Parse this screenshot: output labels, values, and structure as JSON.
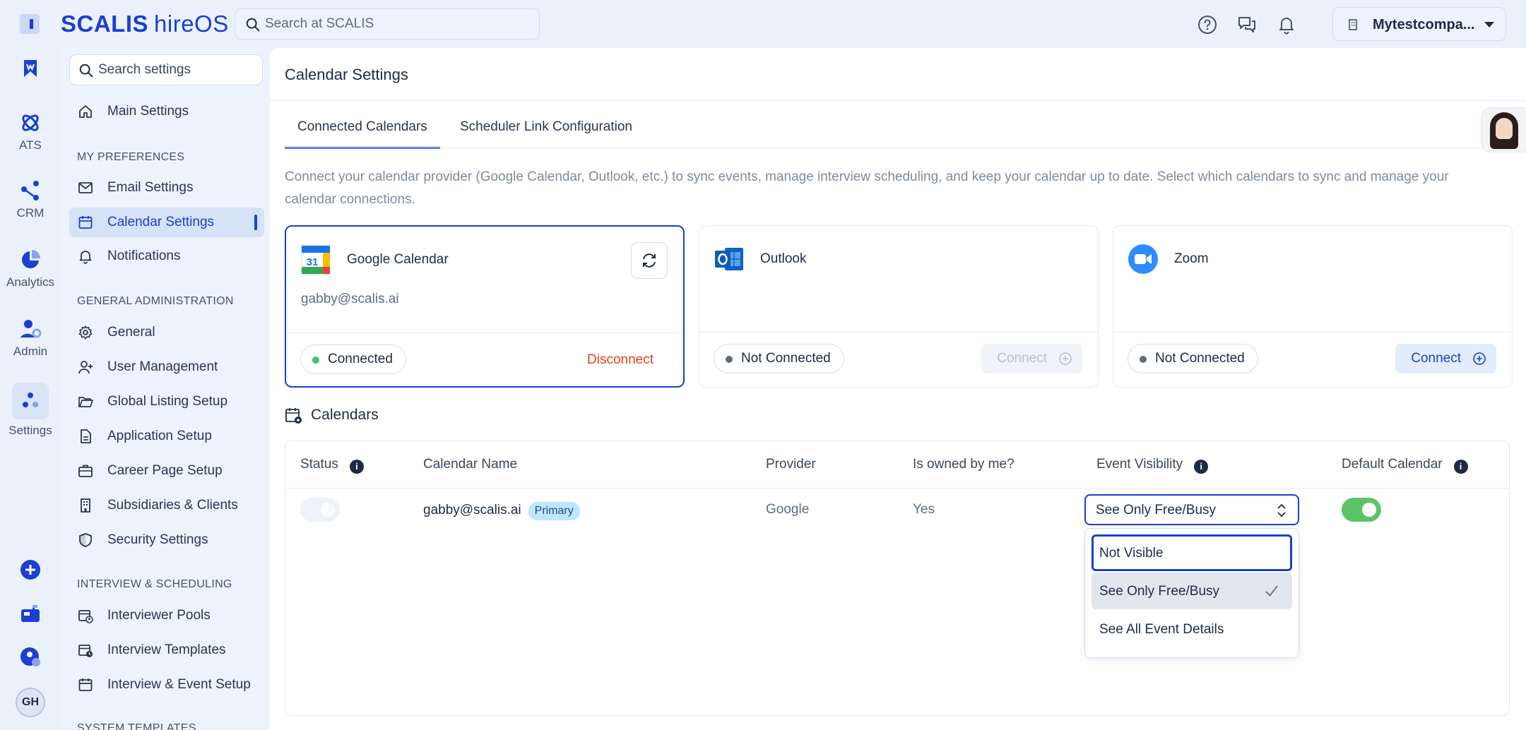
{
  "app": {
    "brand_main": "SCALIS",
    "brand_sub": "hireOS"
  },
  "topbar": {
    "search_placeholder": "Search at SCALIS",
    "company_name": "Mytestcompa..."
  },
  "rail": {
    "items": [
      {
        "label": "ATS"
      },
      {
        "label": "CRM"
      },
      {
        "label": "Analytics"
      },
      {
        "label": "Admin"
      },
      {
        "label": "Settings"
      }
    ],
    "user_initials": "GH"
  },
  "sidebar": {
    "search_placeholder": "Search settings",
    "main_settings": "Main Settings",
    "sections": [
      {
        "title": "MY PREFERENCES"
      },
      {
        "title": "GENERAL ADMINISTRATION"
      },
      {
        "title": "INTERVIEW & SCHEDULING"
      },
      {
        "title": "SYSTEM TEMPLATES"
      }
    ],
    "items": [
      "Email Settings",
      "Calendar Settings",
      "Notifications",
      "General",
      "User Management",
      "Global Listing Setup",
      "Application Setup",
      "Career Page Setup",
      "Subsidiaries & Clients",
      "Security Settings",
      "Interviewer Pools",
      "Interview Templates",
      "Interview & Event Setup"
    ]
  },
  "main": {
    "title": "Calendar Settings",
    "tabs": [
      {
        "label": "Connected Calendars"
      },
      {
        "label": "Scheduler Link Configuration"
      }
    ],
    "description": "Connect your calendar provider (Google Calendar, Outlook, etc.) to sync events, manage interview scheduling, and keep your calendar up to date. Select which calendars to sync and manage your calendar connections.",
    "providers": [
      {
        "name": "Google Calendar",
        "email": "gabby@scalis.ai",
        "status": "Connected",
        "action": "Disconnect"
      },
      {
        "name": "Outlook",
        "status": "Not Connected",
        "action": "Connect"
      },
      {
        "name": "Zoom",
        "status": "Not Connected",
        "action": "Connect"
      }
    ],
    "calendars": {
      "title": "Calendars",
      "columns": [
        "Status",
        "Calendar Name",
        "Provider",
        "Is owned by me?",
        "Event Visibility",
        "Default Calendar"
      ],
      "rows": [
        {
          "name": "gabby@scalis.ai",
          "badge": "Primary",
          "provider": "Google",
          "owned": "Yes",
          "visibility": "See Only Free/Busy"
        }
      ],
      "visibility_options": [
        "Not Visible",
        "See Only Free/Busy",
        "See All Event Details"
      ]
    }
  },
  "colors": {
    "accent": "#1c3fd0",
    "danger": "#e0431c",
    "success": "#5cc466"
  }
}
